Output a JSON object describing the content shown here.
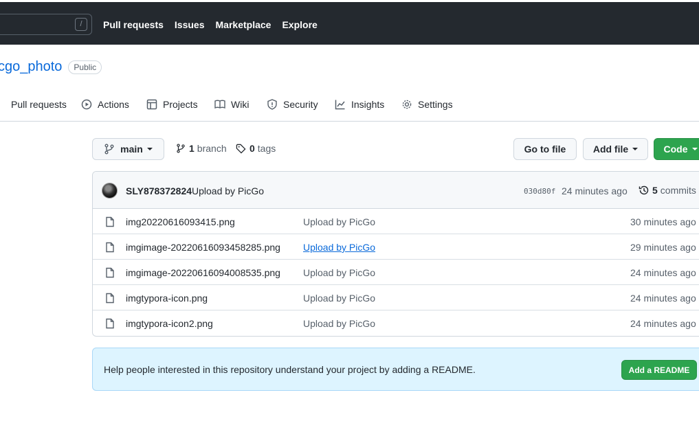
{
  "header": {
    "search_shortcut": "/",
    "nav": [
      "Pull requests",
      "Issues",
      "Marketplace",
      "Explore"
    ]
  },
  "repo": {
    "name": "cgo_photo",
    "visibility": "Public"
  },
  "tabs": [
    {
      "label": "Pull requests",
      "icon": "pull-request-icon"
    },
    {
      "label": "Actions",
      "icon": "play-icon"
    },
    {
      "label": "Projects",
      "icon": "table-icon"
    },
    {
      "label": "Wiki",
      "icon": "book-icon"
    },
    {
      "label": "Security",
      "icon": "shield-icon"
    },
    {
      "label": "Insights",
      "icon": "graph-icon"
    },
    {
      "label": "Settings",
      "icon": "gear-icon"
    }
  ],
  "branchbar": {
    "branch": "main",
    "branch_count": "1",
    "branch_label": "branch",
    "tag_count": "0",
    "tag_label": "tags",
    "go_to_file": "Go to file",
    "add_file": "Add file",
    "code": "Code"
  },
  "commit": {
    "author": "SLY878372824",
    "message": "Upload by PicGo",
    "sha": "030d80f",
    "time": "24 minutes ago",
    "count": "5",
    "count_label": "commits"
  },
  "files": [
    {
      "name": "img20220616093415.png",
      "message": "Upload by PicGo",
      "time": "30 minutes ago"
    },
    {
      "name": "imgimage-20220616093458285.png",
      "message": "Upload by PicGo",
      "time": "29 minutes ago"
    },
    {
      "name": "imgimage-20220616094008535.png",
      "message": "Upload by PicGo",
      "time": "24 minutes ago"
    },
    {
      "name": "imgtypora-icon.png",
      "message": "Upload by PicGo",
      "time": "24 minutes ago"
    },
    {
      "name": "imgtypora-icon2.png",
      "message": "Upload by PicGo",
      "time": "24 minutes ago"
    }
  ],
  "readme": {
    "text": "Help people interested in this repository understand your project by adding a README.",
    "button": "Add a README"
  },
  "colors": {
    "header_bg": "#24292f",
    "link": "#0969da",
    "green": "#2da44e",
    "banner_bg": "#ddf4ff"
  }
}
